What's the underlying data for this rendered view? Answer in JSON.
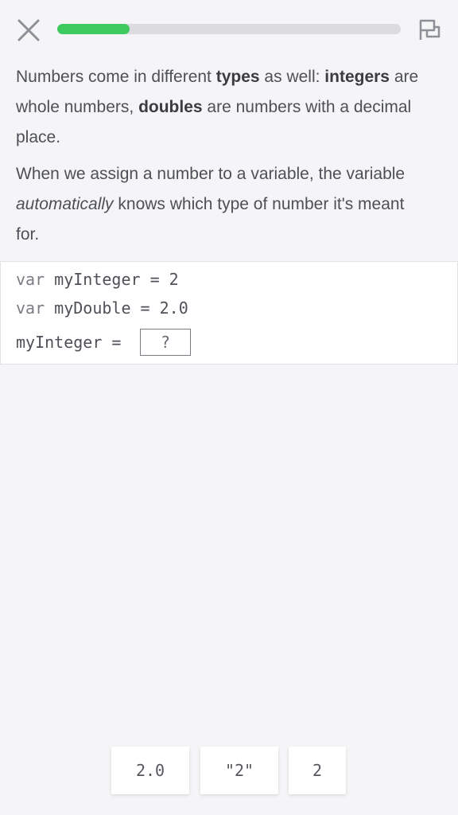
{
  "header": {
    "progress_fraction": 0.21,
    "progress_color": "#3dcb5f",
    "close_icon": "close-icon",
    "report_icon": "report-flag-icon"
  },
  "instructions": {
    "p1": {
      "t1": "Numbers come in different ",
      "b1": "types",
      "t2": " as well: ",
      "b2": "integers",
      "t3": " are whole numbers, ",
      "b3": "doubles",
      "t4": " are numbers with a decimal place."
    },
    "p2": {
      "t1": "When we assign a number to a variable, the variable ",
      "i1": "automatically",
      "t2": " knows which type of number it's meant for."
    }
  },
  "code": {
    "line1_kw": "var",
    "line1_rest": " myInteger = 2",
    "line2_kw": "var",
    "line2_rest": " myDouble = 2.0",
    "line3": "myInteger = ",
    "blank": "?"
  },
  "options": [
    "2.0",
    "\"2\"",
    "2"
  ]
}
